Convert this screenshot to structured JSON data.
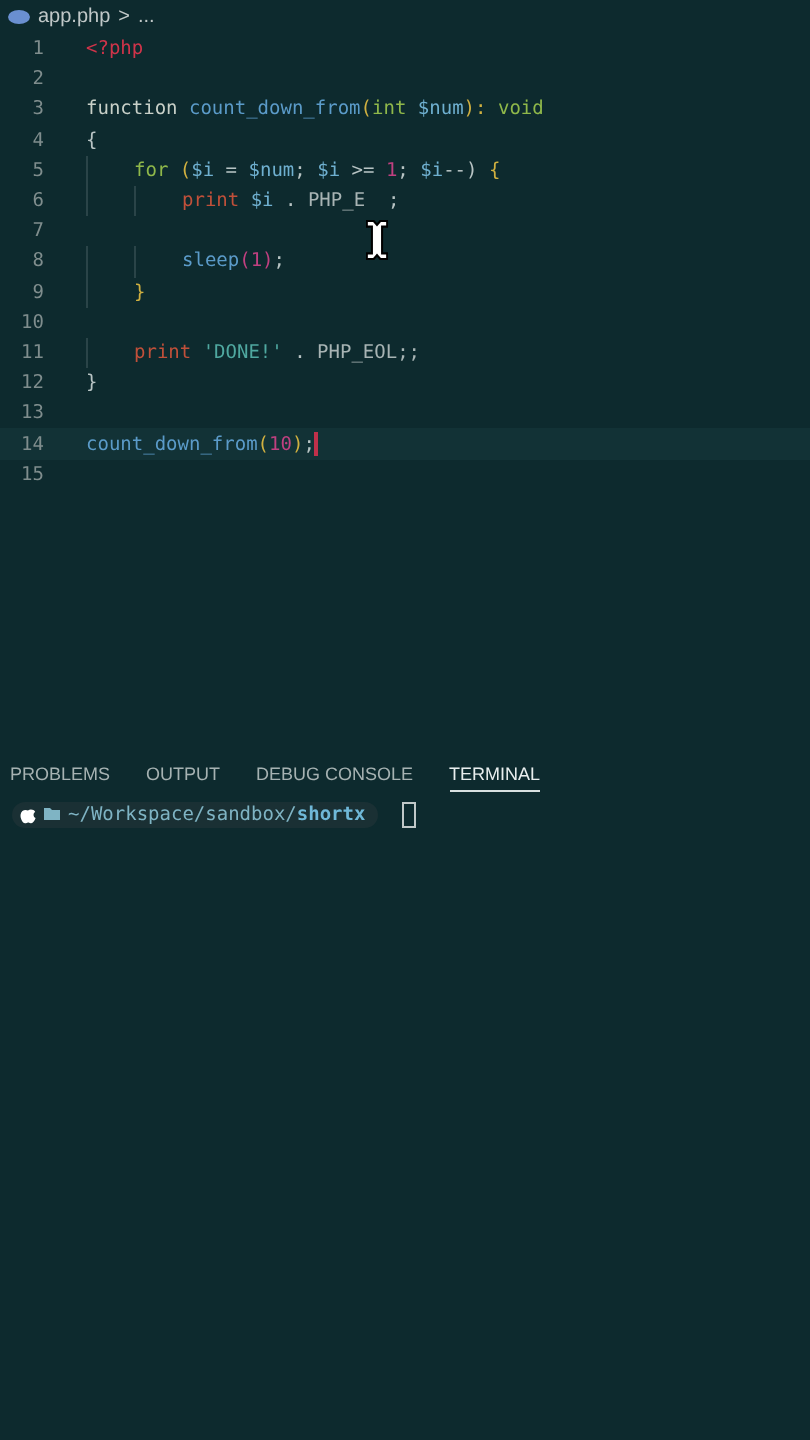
{
  "breadcrumb": {
    "file": "app.php",
    "separator": ">",
    "rest": "..."
  },
  "editor": {
    "lines": [
      {
        "number": "1",
        "active": false,
        "tokens": [
          {
            "kind": "tag",
            "text": "<?php"
          }
        ]
      },
      {
        "number": "2",
        "active": false
      },
      {
        "number": "3",
        "active": false,
        "tokens": [
          {
            "kind": "keyword",
            "text": "function "
          },
          {
            "kind": "function",
            "text": "count_down_from"
          },
          {
            "kind": "punct",
            "text": "("
          },
          {
            "kind": "type",
            "text": "int "
          },
          {
            "kind": "variable",
            "text": "$num"
          },
          {
            "kind": "punct",
            "text": "): "
          },
          {
            "kind": "type",
            "text": "void"
          }
        ]
      },
      {
        "number": "4",
        "active": false,
        "tokens": [
          {
            "kind": "plain",
            "text": "{"
          }
        ]
      },
      {
        "number": "5",
        "active": false,
        "tokens": [
          {
            "kind": "type",
            "text": "    for "
          },
          {
            "kind": "punct",
            "text": "("
          },
          {
            "kind": "variable",
            "text": "$i"
          },
          {
            "kind": "plain",
            "text": " = "
          },
          {
            "kind": "variable",
            "text": "$num"
          },
          {
            "kind": "plain",
            "text": "; "
          },
          {
            "kind": "variable",
            "text": "$i"
          },
          {
            "kind": "plain",
            "text": " >= "
          },
          {
            "kind": "number",
            "text": "1"
          },
          {
            "kind": "plain",
            "text": "; "
          },
          {
            "kind": "variable",
            "text": "$i"
          },
          {
            "kind": "plain",
            "text": "--) "
          },
          {
            "kind": "punct",
            "text": "{"
          }
        ]
      },
      {
        "number": "6",
        "active": false,
        "tokens": [
          {
            "kind": "print",
            "text": "        print "
          },
          {
            "kind": "variable",
            "text": "$i"
          },
          {
            "kind": "plain",
            "text": " . "
          },
          {
            "kind": "constant",
            "text": "PHP_E"
          },
          {
            "kind": "plain",
            "text": "  ;"
          }
        ]
      },
      {
        "number": "7",
        "active": false
      },
      {
        "number": "8",
        "active": false,
        "tokens": [
          {
            "kind": "function",
            "text": "        sleep"
          },
          {
            "kind": "number",
            "text": "(1)"
          },
          {
            "kind": "plain",
            "text": ";"
          }
        ]
      },
      {
        "number": "9",
        "active": false,
        "tokens": [
          {
            "kind": "punct",
            "text": "    }"
          }
        ]
      },
      {
        "number": "10",
        "active": false
      },
      {
        "number": "11",
        "active": false,
        "tokens": [
          {
            "kind": "print",
            "text": "    print "
          },
          {
            "kind": "string",
            "text": "'DONE!'"
          },
          {
            "kind": "plain",
            "text": " . "
          },
          {
            "kind": "constant",
            "text": "PHP_EOL;;"
          }
        ]
      },
      {
        "number": "12",
        "active": false,
        "tokens": [
          {
            "kind": "plain",
            "text": "}"
          }
        ]
      },
      {
        "number": "13",
        "active": false
      },
      {
        "number": "14",
        "active": true,
        "tokens": [
          {
            "kind": "function",
            "text": "count_down_from"
          },
          {
            "kind": "punct",
            "text": "("
          },
          {
            "kind": "number",
            "text": "10"
          },
          {
            "kind": "punct",
            "text": ")"
          },
          {
            "kind": "plain",
            "text": ";"
          }
        ]
      },
      {
        "number": "15",
        "active": false
      }
    ]
  },
  "panel": {
    "tabs": [
      {
        "label": "PROBLEMS",
        "selected": false
      },
      {
        "label": "OUTPUT",
        "selected": false
      },
      {
        "label": "DEBUG CONSOLE",
        "selected": false
      },
      {
        "label": "TERMINAL",
        "selected": true
      }
    ],
    "prompt": {
      "path": "~/Workspace/sandbox/",
      "folder": "shortx"
    }
  }
}
